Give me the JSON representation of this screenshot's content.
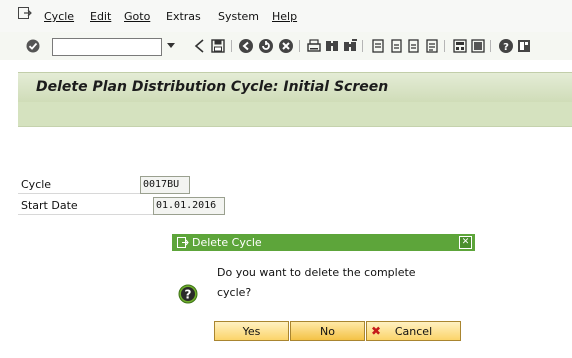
{
  "menu": {
    "items": [
      "Cycle",
      "Edit",
      "Goto",
      "Extras",
      "System",
      "Help"
    ],
    "underline": [
      "C",
      "E",
      "G",
      "a",
      "y",
      "H"
    ]
  },
  "toolbar": {
    "command_field_value": "",
    "icons": [
      "checkmark-icon",
      "save-icon",
      "back-icon",
      "exit-icon",
      "cancel-icon",
      "print-icon",
      "find-icon",
      "find-next-icon",
      "first-page-icon",
      "previous-page-icon",
      "next-page-icon",
      "last-page-icon",
      "new-session-icon",
      "shortcut-icon",
      "help-icon",
      "layout-icon"
    ]
  },
  "page": {
    "title": "Delete Plan Distribution Cycle: Initial Screen"
  },
  "form": {
    "cycle_label": "Cycle",
    "cycle_value": "0017BU",
    "start_date_label": "Start Date",
    "start_date_value": "01.01.2016"
  },
  "dialog": {
    "title": "Delete Cycle",
    "message_line1": "Do you want to delete the complete",
    "message_line2": "cycle?",
    "yes_label": "Yes",
    "no_label": "No",
    "cancel_label": "Cancel"
  },
  "colors": {
    "dialog_header": "#5da53a",
    "title_bar": "#d5e2bf",
    "button": "#fbd46a"
  }
}
